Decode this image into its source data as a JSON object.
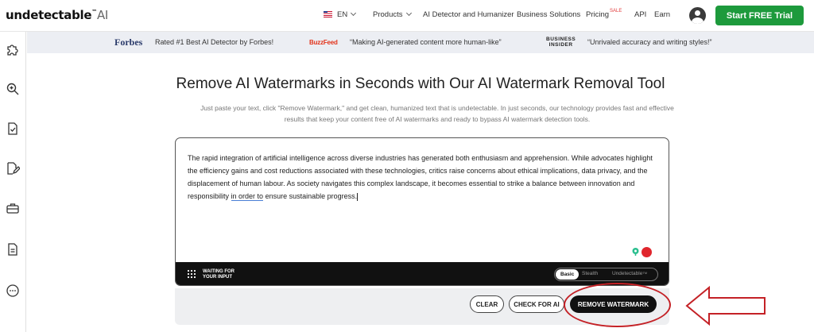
{
  "brand": {
    "name": "undetectable",
    "tm": "™",
    "suffix": "AI"
  },
  "nav": {
    "language": "EN",
    "products": "Products",
    "detector": "AI Detector and Humanizer",
    "business": "Business Solutions",
    "pricing": "Pricing",
    "sale_badge": "SALE",
    "api": "API",
    "earn": "Earn",
    "cta": "Start FREE Trial"
  },
  "sidebar": {
    "icons": [
      "puzzle-icon",
      "search-zoom-icon",
      "document-check-icon",
      "edit-document-icon",
      "briefcase-icon",
      "document-icon",
      "more-icon"
    ]
  },
  "press": {
    "forbes_logo": "Forbes",
    "forbes_quote": "Rated #1 Best AI Detector by Forbes!",
    "buzzfeed_logo": "BuzzFeed",
    "buzzfeed_quote": "“Making AI-generated content more human-like”",
    "bi_logo_line1": "BUSINESS",
    "bi_logo_line2": "INSIDER",
    "bi_quote": "“Unrivaled accuracy and writing styles!”"
  },
  "hero": {
    "title": "Remove AI Watermarks in Seconds with Our AI Watermark Removal Tool",
    "subtitle_line1": "Just paste your text, click \"Remove Watermark,\" and get clean, humanized text that is undetectable. In just seconds, our technology provides fast and effective",
    "subtitle_line2": "results that keep your content free of AI watermarks and ready to bypass AI watermark detection tools."
  },
  "editor": {
    "text_part1": "The rapid integration of artificial intelligence across diverse industries has generated both enthusiasm and apprehension. While advocates highlight the efficiency gains and cost reductions associated with these technologies, critics raise concerns about ethical implications, data privacy, and the displacement of human labour. As society navigates this complex landscape, it becomes essential to strike a balance between innovation and responsibility ",
    "text_underlined": "in order to",
    "text_part2": " ensure sustainable progress.",
    "status_line1": "WAITING FOR",
    "status_line2": "YOUR INPUT",
    "modes": {
      "basic": "Basic",
      "stealth": "Stealth",
      "undetectable": "Undetectable",
      "undetectable_tm": "TM"
    }
  },
  "actions": {
    "clear": "CLEAR",
    "check": "CHECK FOR AI",
    "remove": "REMOVE WATERMARK"
  },
  "colors": {
    "cta_green": "#1d9a3c",
    "annotation_red": "#c42126",
    "press_bg": "#eceef3"
  }
}
